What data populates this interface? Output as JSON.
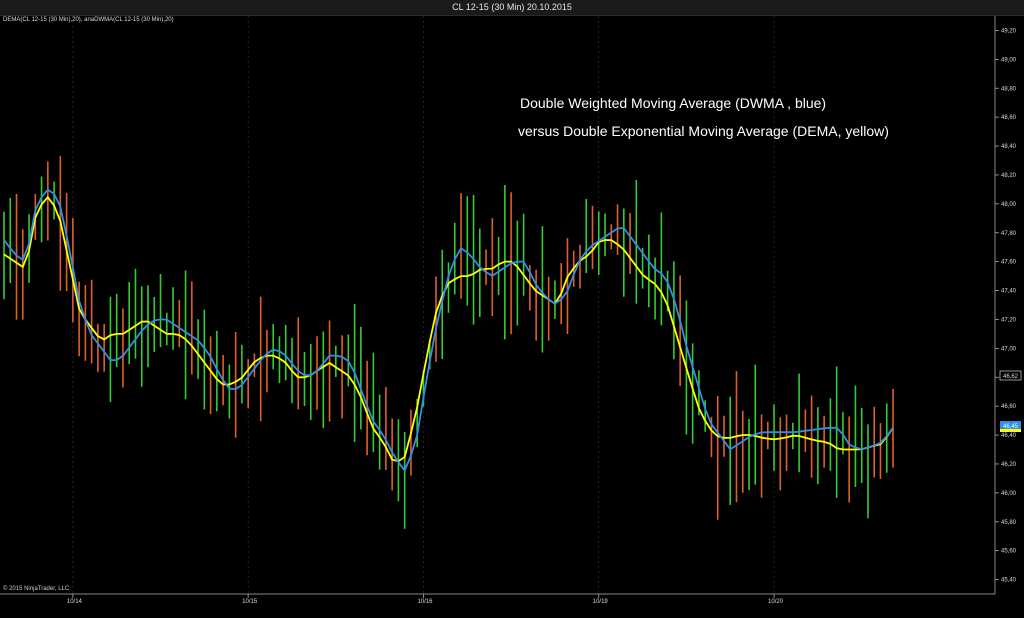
{
  "window": {
    "title": "CL 12-15 (30 Min)  20.10.2015"
  },
  "indicator_label": "DEMA(CL 12-15 (30 Min),20), anaDWMA(CL 12-15 (30 Min),20)",
  "copyright": "© 2015 NinjaTrader, LLC",
  "annotations": {
    "line1": "Double Weighted Moving Average (DWMA , blue)",
    "line2": "versus Double Exponential Moving Average (DEMA, yellow)"
  },
  "colors": {
    "background": "#000000",
    "dwma": "#2f8fe6",
    "dema": "#ffff00",
    "up_bar": "#33cc33",
    "down_bar": "#e0602a",
    "grid": "#3a3a3a"
  },
  "chart_data": {
    "type": "line",
    "title": "CL 12-15 (30 Min)  20.10.2015",
    "y_ticks": [
      "49,20",
      "49,00",
      "48,80",
      "48,60",
      "48,40",
      "48,20",
      "48,00",
      "47,80",
      "47,60",
      "47,40",
      "47,20",
      "47,00",
      "46,80",
      "46,60",
      "46,40",
      "46,20",
      "46,00",
      "45,80",
      "45,60",
      "45,40"
    ],
    "ylim": [
      45.3,
      49.3
    ],
    "x_ticks": [
      "10/14",
      "10/15",
      "10/16",
      "10/19",
      "10/20"
    ],
    "x_tick_index": [
      11,
      39,
      67,
      95,
      123
    ],
    "bar_count": 143,
    "price_labels": {
      "last_close": "46,62",
      "moving_average": "46,45"
    },
    "series": [
      {
        "name": "DWMA",
        "color": "#2f8fe6",
        "values": [
          47.75,
          47.65,
          47.6,
          48.0,
          48.1,
          48.05,
          47.7,
          47.3,
          47.1,
          47.0,
          46.9,
          46.95,
          47.05,
          47.15,
          47.2,
          47.2,
          47.15,
          47.1,
          47.05,
          46.95,
          46.8,
          46.7,
          46.75,
          46.85,
          46.95,
          47.0,
          46.95,
          46.85,
          46.8,
          46.85,
          46.95,
          46.95,
          46.9,
          46.7,
          46.5,
          46.4,
          46.25,
          46.15,
          46.35,
          46.8,
          47.2,
          47.5,
          47.7,
          47.65,
          47.55,
          47.5,
          47.55,
          47.6,
          47.6,
          47.45,
          47.35,
          47.3,
          47.4,
          47.6,
          47.7,
          47.75,
          47.8,
          47.85,
          47.75,
          47.65,
          47.55,
          47.5,
          47.3,
          47.0,
          46.75,
          46.5,
          46.4,
          46.3,
          46.35,
          46.4,
          46.42,
          46.42,
          46.42,
          46.42,
          46.43,
          46.44,
          46.45,
          46.45,
          46.33,
          46.3,
          46.32,
          46.35,
          46.45
        ]
      },
      {
        "name": "DEMA",
        "color": "#ffff00",
        "values": [
          47.65,
          47.6,
          47.55,
          47.95,
          48.05,
          47.95,
          47.6,
          47.25,
          47.15,
          47.05,
          47.1,
          47.1,
          47.15,
          47.2,
          47.15,
          47.1,
          47.1,
          47.05,
          46.95,
          46.85,
          46.75,
          46.75,
          46.8,
          46.9,
          46.95,
          46.95,
          46.9,
          46.8,
          46.8,
          46.85,
          46.9,
          46.85,
          46.8,
          46.65,
          46.45,
          46.35,
          46.2,
          46.25,
          46.55,
          46.95,
          47.3,
          47.45,
          47.5,
          47.5,
          47.55,
          47.55,
          47.6,
          47.6,
          47.5,
          47.4,
          47.35,
          47.3,
          47.5,
          47.6,
          47.65,
          47.75,
          47.75,
          47.7,
          47.6,
          47.5,
          47.45,
          47.35,
          47.1,
          46.85,
          46.6,
          46.45,
          46.38,
          46.38,
          46.4,
          46.4,
          46.38,
          46.37,
          46.38,
          46.4,
          46.38,
          46.36,
          46.35,
          46.3,
          46.3,
          46.3,
          46.32,
          46.34,
          46.45
        ]
      }
    ]
  }
}
